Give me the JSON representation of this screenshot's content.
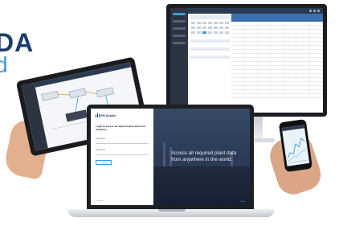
{
  "hero": {
    "line1": "DA",
    "line2": "d"
  },
  "laptop": {
    "brand": "RH.Scada",
    "login_heading": "Login to access all required plant data from anywhere",
    "username_label": "Username",
    "password_label": "Password",
    "login_button": "LOGIN",
    "login_footer": "© copyright",
    "caption": "Access all required plant data from anywhere in the world.",
    "hero_footer": "Scada"
  },
  "colors": {
    "brand_dark": "#1a3f6b",
    "brand_light": "#3a9bd5"
  }
}
